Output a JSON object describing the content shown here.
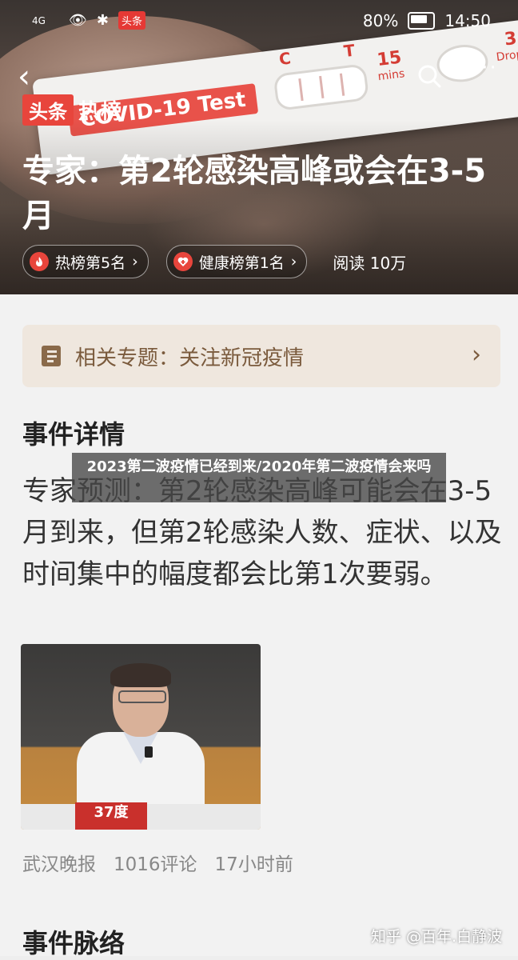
{
  "status_bar": {
    "signal": "4G",
    "app_badge": "头条",
    "battery": "80%",
    "time": "14:50"
  },
  "hero": {
    "test_label": "COVID-19 Test",
    "ct": "C T",
    "mins_num": "15",
    "mins": "mins",
    "drops_num": "3",
    "drops": "Drops",
    "brand_a": "头条",
    "brand_b": "热榜",
    "headline": "专家：第2轮感染高峰或会在3-5月",
    "chip1": "热榜第5名",
    "chip2": "健康榜第1名",
    "reads": "阅读 10万"
  },
  "topic": {
    "label": "相关专题：关注新冠疫情"
  },
  "section1": {
    "title": "事件详情",
    "paragraph": "专家预测：第2轮感染高峰可能会在3-5月到来，但第2轮感染人数、症状、以及时间集中的幅度都会比第1次要弱。"
  },
  "photo": {
    "badge": "37度"
  },
  "meta": {
    "source": "武汉晚报",
    "comments": "1016评论",
    "time": "17小时前"
  },
  "section2": {
    "title": "事件脉络"
  },
  "overlay": {
    "caption": "2023第二波疫情已经到来/2020年第二波疫情会来吗"
  },
  "watermark": "知乎 @百年.白静波",
  "colors": {
    "brand_red": "#e8453c",
    "topic_bg": "#efe7de",
    "topic_text": "#7a5a3c"
  }
}
